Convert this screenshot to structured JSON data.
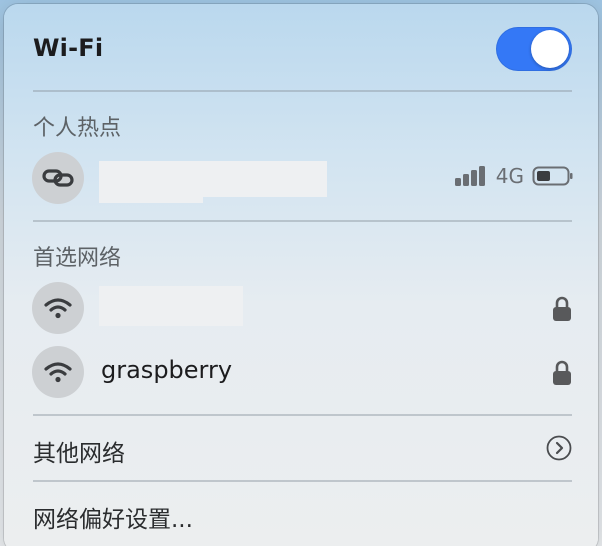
{
  "wifi": {
    "title": "Wi-Fi",
    "enabled": true,
    "toggle_color": "#3478f6"
  },
  "hotspot": {
    "section_title": "个人热点",
    "device": {
      "icon": "link-icon",
      "name": "",
      "network_type": "4G",
      "signal_bars": 4,
      "battery_level": 0.4
    }
  },
  "preferred": {
    "section_title": "首选网络",
    "networks": [
      {
        "name": "",
        "icon": "wifi-icon",
        "locked": true
      },
      {
        "name": "graspberry",
        "icon": "wifi-icon",
        "locked": true
      }
    ]
  },
  "other": {
    "label": "其他网络",
    "icon": "chevron-right-circle-icon"
  },
  "footer": {
    "label": "网络偏好设置..."
  }
}
